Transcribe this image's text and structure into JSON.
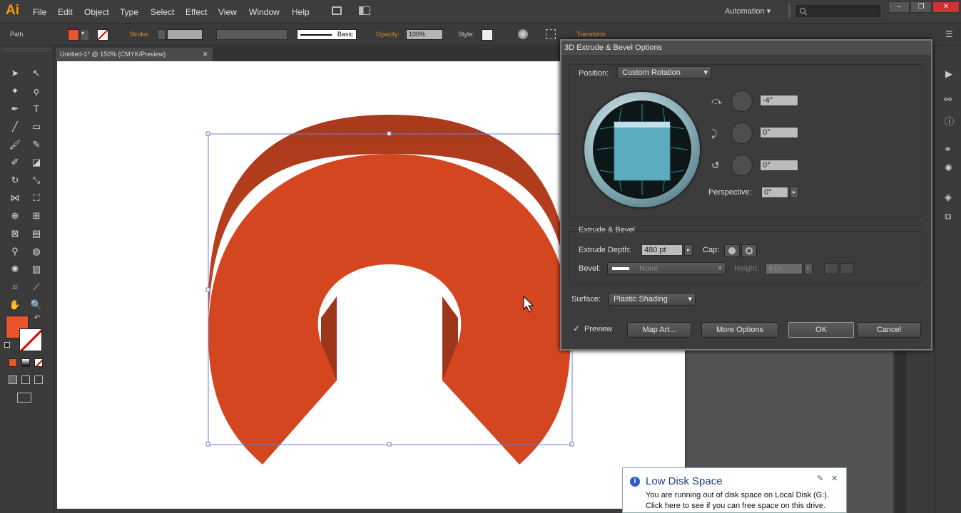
{
  "app": {
    "logo": "Ai",
    "workspace": "Automation",
    "workspace_chevron": "▾"
  },
  "menu": [
    "File",
    "Edit",
    "Object",
    "Type",
    "Select",
    "Effect",
    "View",
    "Window",
    "Help"
  ],
  "control_bar": {
    "selection_type": "Path",
    "stroke_label": "Stroke:",
    "brush": "Basic",
    "opacity_label": "Opacity:",
    "opacity_value": "100%",
    "style_label": "Style:",
    "transform_label": "Transform"
  },
  "document_tab": {
    "title": "Untitled-1* @ 150% (CMYK/Preview)",
    "close": "✕"
  },
  "dialog": {
    "title": "3D Extrude & Bevel Options",
    "position_label": "Position:",
    "position_value": "Custom Rotation",
    "rot_x": "-4°",
    "rot_y": "0°",
    "rot_z": "0°",
    "perspective_label": "Perspective:",
    "perspective_value": "0°",
    "extrude_section": "Extrude & Bevel",
    "extrude_depth_label": "Extrude Depth:",
    "extrude_depth_value": "480 pt",
    "cap_label": "Cap:",
    "bevel_label": "Bevel:",
    "bevel_value": "None",
    "height_label": "Height:",
    "height_value": "4 pt",
    "surface_label": "Surface:",
    "surface_value": "Plastic Shading",
    "preview_label": "Preview",
    "map_art": "Map Art...",
    "more_options": "More Options",
    "ok": "OK",
    "cancel": "Cancel"
  },
  "toast": {
    "title": "Low Disk Space",
    "line1": "You are running out of disk space on Local Disk (G:).",
    "line2": "Click here to see if you can free space on this drive.",
    "close": "✕"
  },
  "colors": {
    "fill": "#e8542b",
    "shape_face": "#d4461f",
    "shape_side": "#b13e1d",
    "accent": "#ff9a00"
  }
}
